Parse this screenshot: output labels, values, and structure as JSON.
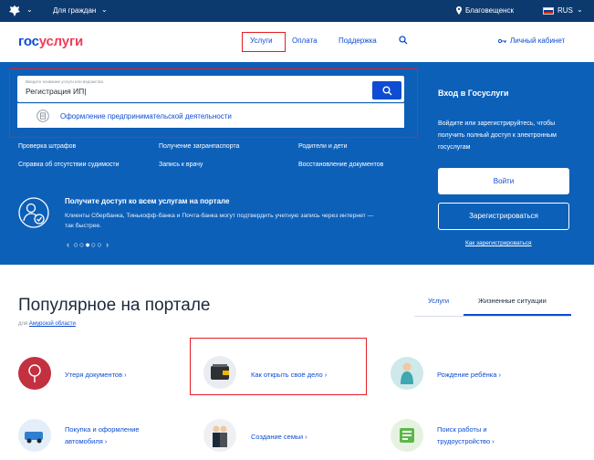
{
  "topbar": {
    "for_citizens": "Для граждан",
    "location": "Благовещенск",
    "lang": "RUS"
  },
  "header": {
    "logo_a": "гос",
    "logo_b": "услуги",
    "nav": [
      "Услуги",
      "Оплата",
      "Поддержка"
    ],
    "cabinet": "Личный кабинет"
  },
  "search": {
    "placeholder": "Введите название услуги или ведомства",
    "value": "Регистрация ИП|",
    "suggestion": "Оформление предпринимательской деятельности"
  },
  "quick_links": [
    "Проверка штрафов",
    "Получение загранпаспорта",
    "Родители и дети",
    "Справка об отсутствии судимости",
    "Запись к врачу",
    "Восстановление документов"
  ],
  "promo": {
    "title": "Получите доступ ко всем услугам на портале",
    "text": "Клиенты Сбербанка, Тинькофф-банка и Почта-банка могут подтвердить учетную запись через интернет — так быстрее.",
    "pager": "‹ ○○●○○ ›"
  },
  "login": {
    "title": "Вход в Госуслуги",
    "text": "Войдите или зарегистрируйтесь, чтобы получить полный доступ к электронным госуслугам",
    "login_btn": "Войти",
    "register_btn": "Зарегистрироваться",
    "how_register": "Как зарегистрироваться"
  },
  "popular": {
    "title": "Популярное на портале",
    "sub_prefix": "для ",
    "sub_region": "Амурской области",
    "tabs": [
      "Услуги",
      "Жизненные ситуации"
    ],
    "items": [
      {
        "label": "Утеря документов ›"
      },
      {
        "label": "Как открыть своё дело ›"
      },
      {
        "label": "Рождение ребёнка ›"
      },
      {
        "label": "Покупка и оформление автомобиля ›"
      },
      {
        "label": "Создание семьи ›"
      },
      {
        "label": "Поиск работы и трудоустройство ›"
      }
    ]
  },
  "colors": {
    "topbar": "#0d3a6e",
    "hero": "#0d60b8",
    "accent": "#0d4cd3",
    "brand_red": "#ee3f58",
    "highlight": "#e31e24"
  },
  "icons": [
    "emblem-icon",
    "location-icon",
    "flag-icon",
    "search-icon",
    "key-icon",
    "document-icon",
    "user-check-icon"
  ]
}
